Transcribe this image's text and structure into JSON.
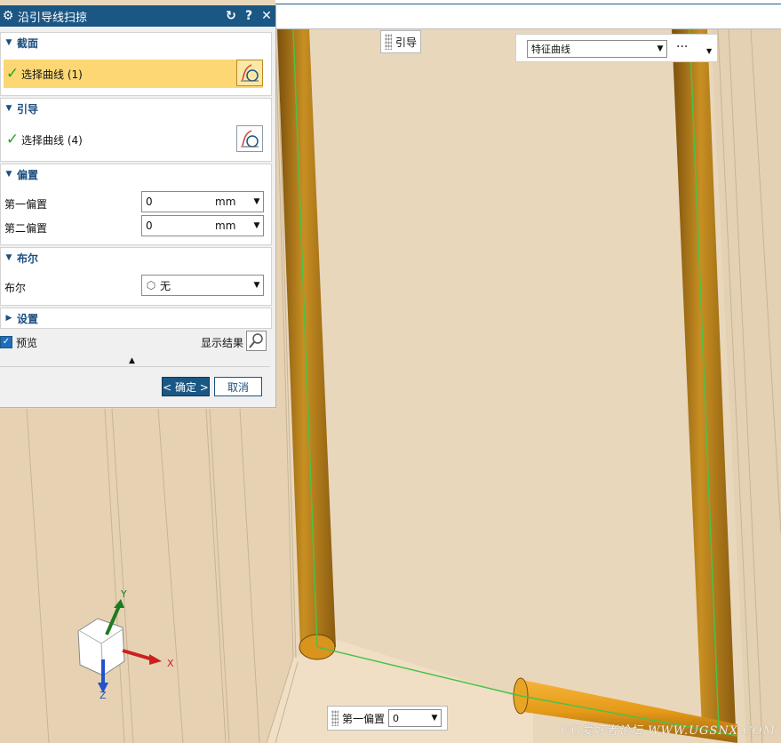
{
  "dialog": {
    "title": "沿引导线扫掠",
    "section_panel": {
      "title": "截面",
      "select_label": "选择曲线 (1)"
    },
    "guide_panel": {
      "title": "引导",
      "select_label": "选择曲线 (4)"
    },
    "offset_panel": {
      "title": "偏置",
      "first_label": "第一偏置",
      "first_value": "0",
      "first_unit": "mm",
      "second_label": "第二偏置",
      "second_value": "0",
      "second_unit": "mm"
    },
    "boolean_panel": {
      "title": "布尔",
      "label": "布尔",
      "value": "无"
    },
    "settings_panel": {
      "title": "设置"
    },
    "preview": {
      "label": "预览",
      "show_result_label": "显示结果"
    },
    "ok_label": "< 确定 >",
    "cancel_label": "取消"
  },
  "viewport": {
    "guide_chip_label": "引导",
    "filter_value": "特征曲线",
    "more_label": "···",
    "offset_chip_label": "第一偏置",
    "offset_chip_value": "0",
    "axis": {
      "x": "X",
      "y": "Y",
      "z": "Z"
    },
    "watermark": "UG爱好者论坛 WWW.UGSNX.COM"
  },
  "colors": {
    "titlebar": "#1b5784",
    "active_row": "#fcd774",
    "model_bg": "#ead9bf",
    "tube": "#c4871b",
    "guide_line": "#49c24a"
  }
}
